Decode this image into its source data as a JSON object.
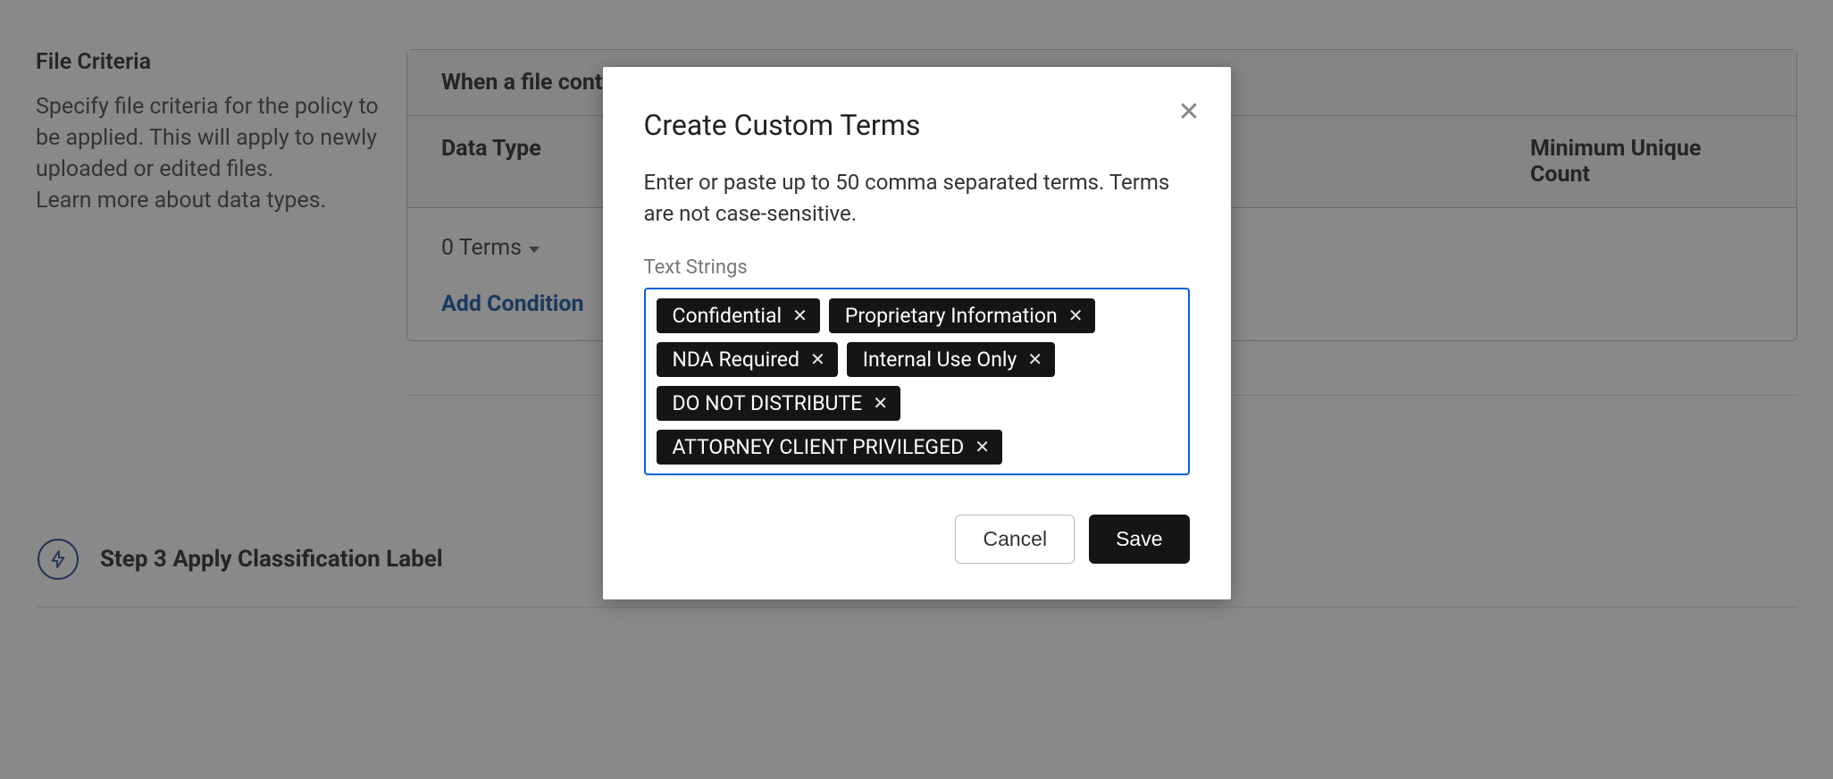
{
  "fileCriteria": {
    "title": "File Criteria",
    "description": "Specify file criteria for the policy to be applied. This will apply to newly uploaded or edited files.",
    "learnMore": "Learn more about data types.",
    "table": {
      "header": "When a file contains",
      "col1": "Data Type",
      "col2": "Minimum Unique Count",
      "termsDropdown": "0 Terms",
      "addCondition": "Add Condition"
    }
  },
  "step3": {
    "label": "Step 3 Apply Classification Label"
  },
  "modal": {
    "title": "Create Custom Terms",
    "description": "Enter or paste up to 50 comma separated terms. Terms are not case-sensitive.",
    "fieldLabel": "Text Strings",
    "tags": [
      "Confidential",
      "Proprietary Information",
      "NDA Required",
      "Internal Use Only",
      "DO NOT DISTRIBUTE",
      "ATTORNEY CLIENT PRIVILEGED"
    ],
    "cancel": "Cancel",
    "save": "Save"
  }
}
